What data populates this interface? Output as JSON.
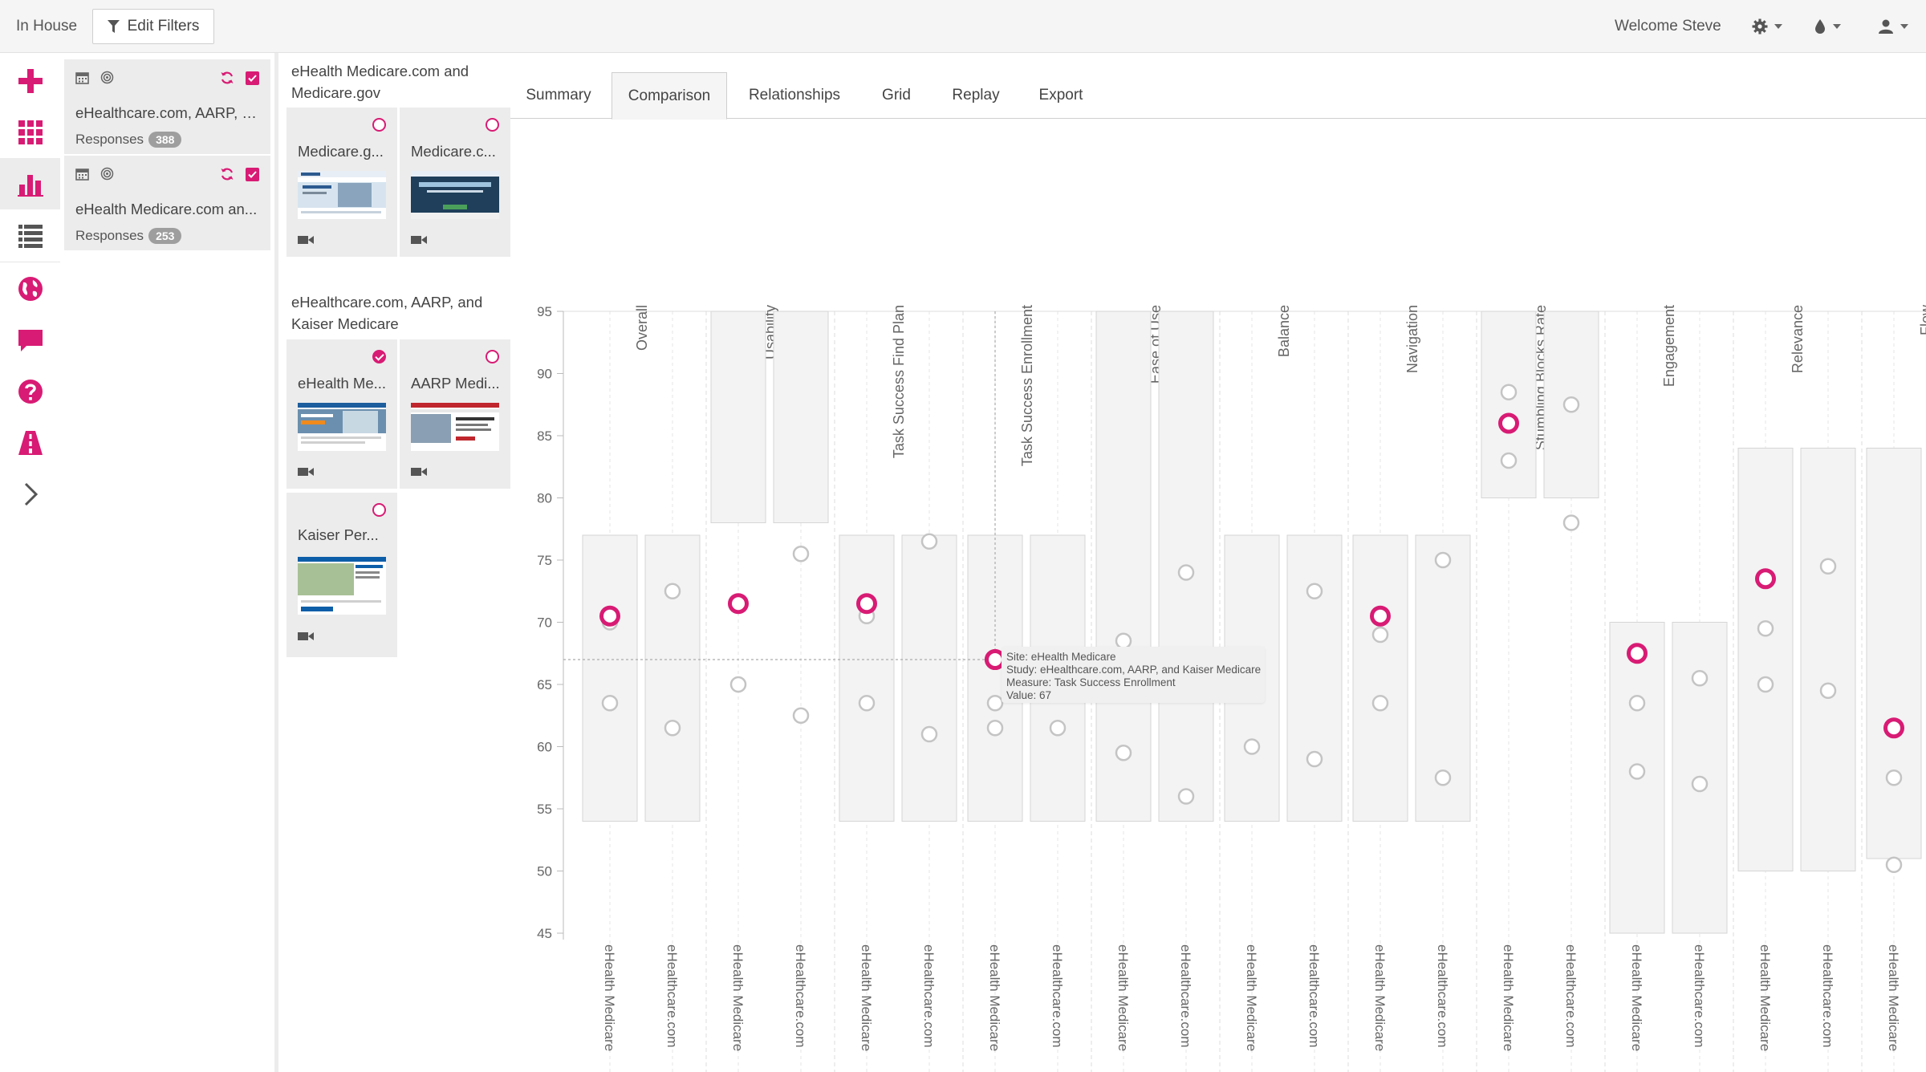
{
  "topbar": {
    "brand": "In House",
    "edit_filters": "Edit Filters",
    "welcome": "Welcome Steve",
    "icons": [
      "settings-icon",
      "theme-drop-icon",
      "user-icon"
    ]
  },
  "rail": {
    "items": [
      "add-icon",
      "grid-icon",
      "bar-chart-icon",
      "list-icon",
      "globe-icon",
      "chat-icon",
      "help-icon",
      "road-icon",
      "chevron-right-icon"
    ],
    "active_index": 2,
    "accent": "#d81b74"
  },
  "studies": [
    {
      "title": "eHealthcare.com, AARP, a...",
      "responses_label": "Responses",
      "responses": "388"
    },
    {
      "title": "eHealth Medicare.com an...",
      "responses_label": "Responses",
      "responses": "253"
    }
  ],
  "site_groups": [
    {
      "title": "eHealth Medicare.com and Medicare.gov",
      "sites": [
        {
          "name": "Medicare.g...",
          "selected": false
        },
        {
          "name": "Medicare.c...",
          "selected": false
        }
      ]
    },
    {
      "title": "eHealthcare.com, AARP, and Kaiser Medicare",
      "sites": [
        {
          "name": "eHealth Me...",
          "selected": true
        },
        {
          "name": "AARP Medi...",
          "selected": false
        },
        {
          "name": "Kaiser Per...",
          "selected": false
        }
      ]
    }
  ],
  "tabs": [
    "Summary",
    "Comparison",
    "Relationships",
    "Grid",
    "Replay",
    "Export"
  ],
  "active_tab": "Comparison",
  "tooltip": {
    "site": "Site: eHealth Medicare",
    "study": "Study: eHealthcare.com, AARP, and Kaiser Medicare",
    "measure": "Measure: Task Success Enrollment",
    "value": "Value: 67"
  },
  "chart_data": {
    "type": "scatter",
    "ylim": [
      45,
      95
    ],
    "y_ticks": [
      95,
      90,
      85,
      80,
      75,
      70,
      65,
      60,
      55,
      50,
      45
    ],
    "column_labels": [
      "eHealth Medicare",
      "eHealthcare.com"
    ],
    "measures": [
      {
        "name": "Overall",
        "cols": [
          {
            "range": [
              54,
              77
            ],
            "points": [
              70,
              63.5
            ],
            "highlight": 70.5
          },
          {
            "range": [
              54,
              77
            ],
            "points": [
              72.5,
              61.5
            ],
            "highlight": null
          }
        ]
      },
      {
        "name": "Usability",
        "cols": [
          {
            "range": [
              78,
              95
            ],
            "points": [
              65
            ],
            "highlight": 71.5
          },
          {
            "range": [
              78,
              95
            ],
            "points": [
              75.5,
              62.5
            ],
            "highlight": null
          }
        ]
      },
      {
        "name": "Task Success Find Plan",
        "cols": [
          {
            "range": [
              54,
              77
            ],
            "points": [
              70.5,
              63.5
            ],
            "highlight": 71.5
          },
          {
            "range": [
              54,
              77
            ],
            "points": [
              76.5,
              61
            ],
            "highlight": null
          }
        ]
      },
      {
        "name": "Task Success Enrollment",
        "cols": [
          {
            "range": [
              54,
              77
            ],
            "points": [
              63.5,
              61.5
            ],
            "highlight": 67
          },
          {
            "range": [
              54,
              77
            ],
            "points": [
              61.5
            ],
            "highlight": null
          }
        ]
      },
      {
        "name": "Ease of Use",
        "cols": [
          {
            "range": [
              54,
              95
            ],
            "points": [
              68.5,
              59.5
            ],
            "highlight": null
          },
          {
            "range": [
              54,
              95
            ],
            "points": [
              74,
              56
            ],
            "highlight": null
          }
        ]
      },
      {
        "name": "Balance",
        "cols": [
          {
            "range": [
              54,
              77
            ],
            "points": [
              60
            ],
            "highlight": null
          },
          {
            "range": [
              54,
              77
            ],
            "points": [
              72.5,
              59
            ],
            "highlight": null
          }
        ]
      },
      {
        "name": "Navigation",
        "cols": [
          {
            "range": [
              54,
              77
            ],
            "points": [
              69,
              63.5
            ],
            "highlight": 70.5
          },
          {
            "range": [
              54,
              77
            ],
            "points": [
              75,
              57.5
            ],
            "highlight": null
          }
        ]
      },
      {
        "name": "Stumbling Blocks Rate",
        "cols": [
          {
            "range": [
              80,
              95
            ],
            "points": [
              88.5,
              83
            ],
            "highlight": 86
          },
          {
            "range": [
              80,
              95
            ],
            "points": [
              87.5,
              78
            ],
            "highlight": null
          }
        ]
      },
      {
        "name": "Engagement",
        "cols": [
          {
            "range": [
              45,
              70
            ],
            "points": [
              63.5,
              58
            ],
            "highlight": 67.5
          },
          {
            "range": [
              45,
              70
            ],
            "points": [
              65.5,
              57
            ],
            "highlight": null
          }
        ]
      },
      {
        "name": "Relevance",
        "cols": [
          {
            "range": [
              50,
              84
            ],
            "points": [
              69.5,
              65
            ],
            "highlight": 73.5
          },
          {
            "range": [
              50,
              84
            ],
            "points": [
              74.5,
              64.5
            ],
            "highlight": null
          }
        ]
      },
      {
        "name": "Flow",
        "cols": [
          {
            "range": [
              51,
              84
            ],
            "points": [
              57.5,
              50.5
            ],
            "highlight": 61.5
          }
        ]
      }
    ]
  }
}
